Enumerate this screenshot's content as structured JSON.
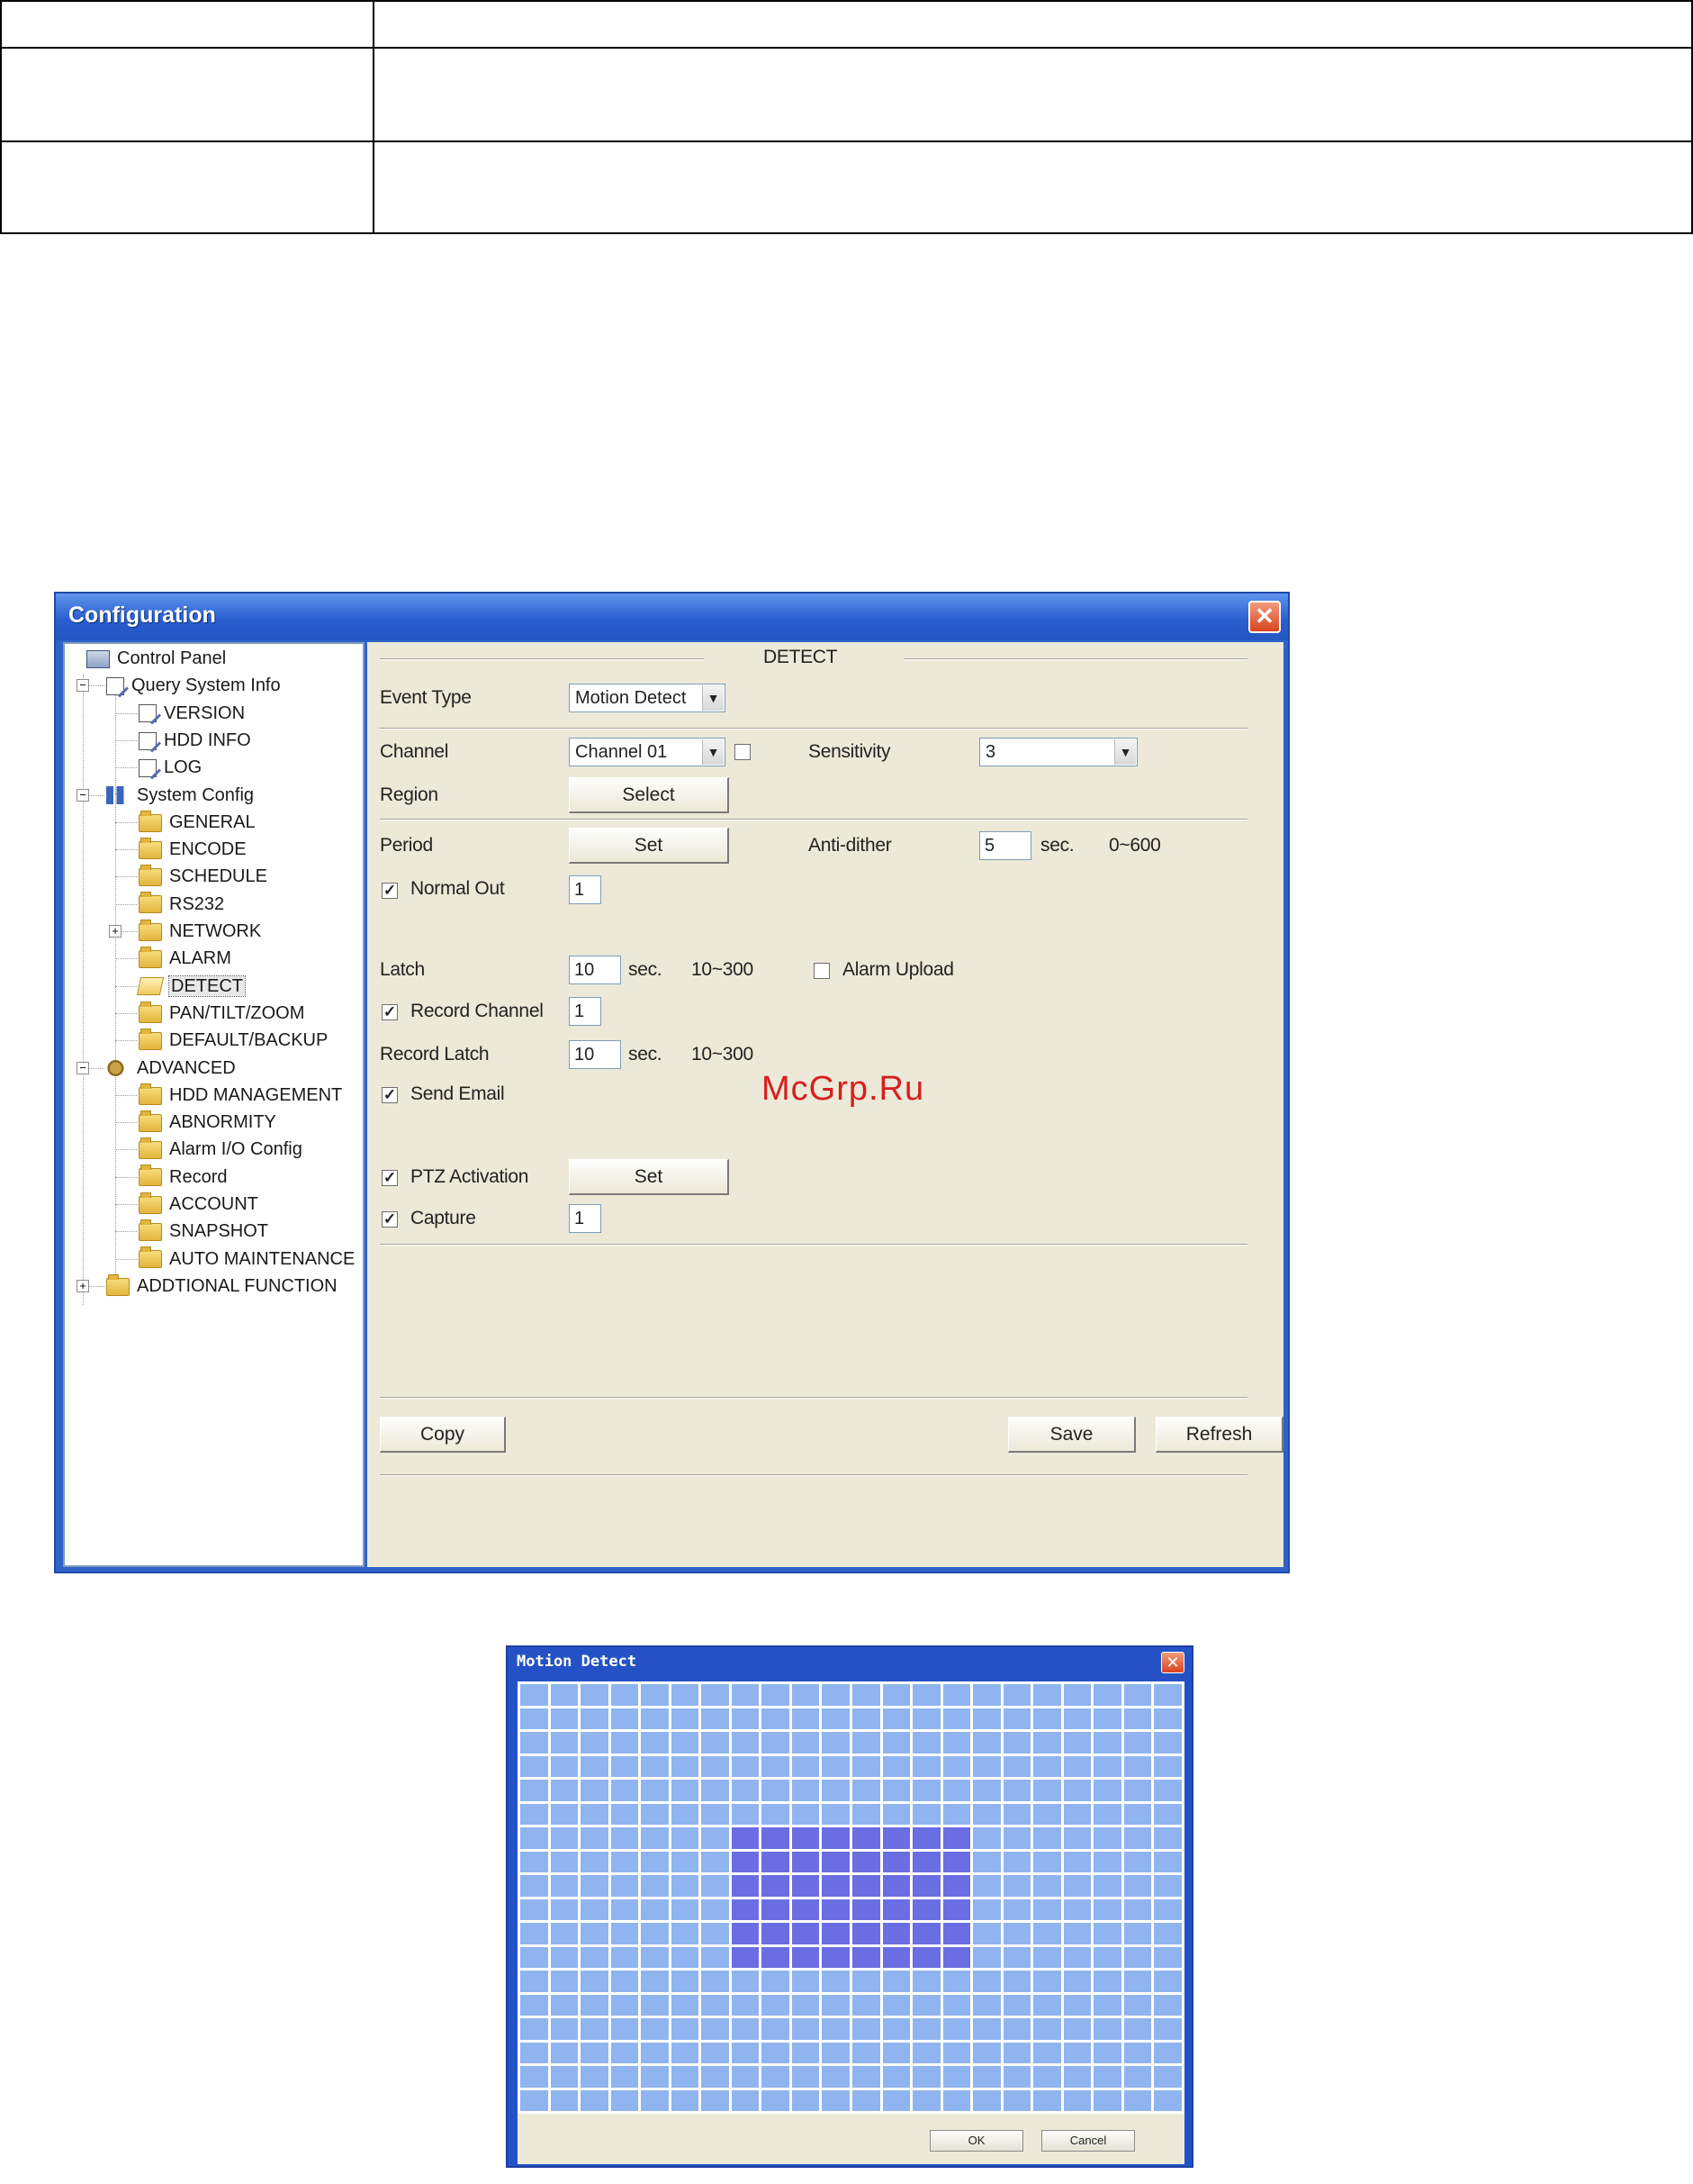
{
  "config_window": {
    "title": "Configuration",
    "tree": [
      {
        "label": "Control Panel",
        "icon": "computer-icon",
        "level": 0
      },
      {
        "label": "Query System Info",
        "icon": "document-icon",
        "level": 1,
        "expander": "-"
      },
      {
        "label": "VERSION",
        "icon": "document-icon",
        "level": 2
      },
      {
        "label": "HDD INFO",
        "icon": "document-icon",
        "level": 2
      },
      {
        "label": "LOG",
        "icon": "document-icon",
        "level": 2
      },
      {
        "label": "System Config",
        "icon": "system-config-icon",
        "level": 1,
        "expander": "-"
      },
      {
        "label": "GENERAL",
        "icon": "folder-icon",
        "level": 2
      },
      {
        "label": "ENCODE",
        "icon": "folder-icon",
        "level": 2
      },
      {
        "label": "SCHEDULE",
        "icon": "folder-icon",
        "level": 2
      },
      {
        "label": "RS232",
        "icon": "folder-icon",
        "level": 2
      },
      {
        "label": "NETWORK",
        "icon": "folder-icon",
        "level": 2,
        "expander": "+"
      },
      {
        "label": "ALARM",
        "icon": "folder-icon",
        "level": 2
      },
      {
        "label": "DETECT",
        "icon": "open-folder-icon",
        "level": 2,
        "selected": true
      },
      {
        "label": "PAN/TILT/ZOOM",
        "icon": "folder-icon",
        "level": 2
      },
      {
        "label": "DEFAULT/BACKUP",
        "icon": "folder-icon",
        "level": 2
      },
      {
        "label": "ADVANCED",
        "icon": "gear-icon",
        "level": 1,
        "expander": "-"
      },
      {
        "label": "HDD MANAGEMENT",
        "icon": "folder-icon",
        "level": 2
      },
      {
        "label": "ABNORMITY",
        "icon": "folder-icon",
        "level": 2
      },
      {
        "label": "Alarm I/O Config",
        "icon": "folder-icon",
        "level": 2
      },
      {
        "label": "Record",
        "icon": "folder-icon",
        "level": 2
      },
      {
        "label": "ACCOUNT",
        "icon": "folder-icon",
        "level": 2
      },
      {
        "label": "SNAPSHOT",
        "icon": "folder-icon",
        "level": 2
      },
      {
        "label": "AUTO MAINTENANCE",
        "icon": "folder-icon",
        "level": 2
      },
      {
        "label": "ADDTIONAL FUNCTION",
        "icon": "folder-icon",
        "level": 1,
        "expander": "+"
      }
    ],
    "panel": {
      "section_title": "DETECT",
      "event_type_label": "Event Type",
      "event_type_value": "Motion Detect",
      "channel_label": "Channel",
      "channel_value": "Channel 01",
      "channel_all_checked": false,
      "sensitivity_label": "Sensitivity",
      "sensitivity_value": "3",
      "region_label": "Region",
      "region_button": "Select",
      "period_label": "Period",
      "period_button": "Set",
      "anti_dither_label": "Anti-dither",
      "anti_dither_value": "5",
      "anti_dither_unit": "sec.",
      "anti_dither_range": "0~600",
      "normal_out_label": "Normal Out",
      "normal_out_checked": true,
      "normal_out_value": "1",
      "latch_label": "Latch",
      "latch_value": "10",
      "latch_unit": "sec.",
      "latch_range": "10~300",
      "alarm_upload_label": "Alarm Upload",
      "alarm_upload_checked": false,
      "record_channel_label": "Record Channel",
      "record_channel_checked": true,
      "record_channel_value": "1",
      "record_latch_label": "Record Latch",
      "record_latch_value": "10",
      "record_latch_unit": "sec.",
      "record_latch_range": "10~300",
      "send_email_label": "Send Email",
      "send_email_checked": true,
      "ptz_activation_label": "PTZ Activation",
      "ptz_activation_checked": true,
      "ptz_button": "Set",
      "capture_label": "Capture",
      "capture_checked": true,
      "capture_value": "1",
      "copy_button": "Copy",
      "save_button": "Save",
      "refresh_button": "Refresh"
    }
  },
  "watermark": "McGrp.Ru",
  "motion_window": {
    "title": "Motion Detect",
    "grid_rows": 18,
    "grid_cols": 22,
    "selected_rows": [
      6,
      11
    ],
    "selected_cols": [
      7,
      14
    ],
    "cell_color": "#8fb4ef",
    "selected_color": "#6b6de3",
    "ok_button": "OK",
    "cancel_button": "Cancel"
  },
  "colors": {
    "titlebar": "#2a5fd0",
    "panel_bg": "#ece9d8"
  }
}
